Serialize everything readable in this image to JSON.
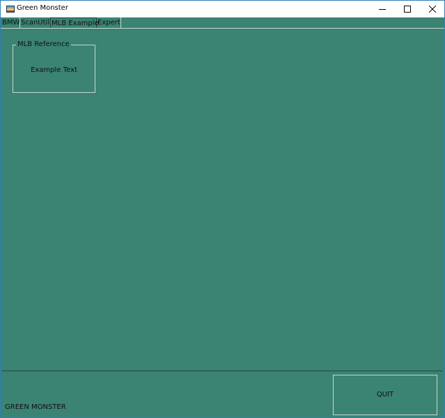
{
  "window": {
    "title": "Green Monster",
    "controls": {
      "minimize_icon": "minimize-icon",
      "maximize_icon": "maximize-icon",
      "close_icon": "close-icon"
    }
  },
  "tabs": [
    {
      "label": "BMW",
      "selected": false
    },
    {
      "label": "ScanUtil",
      "selected": false
    },
    {
      "label": "MLB Example",
      "selected": true
    },
    {
      "label": "Expert",
      "selected": false
    }
  ],
  "group": {
    "label": "MLB Reference",
    "text": "Example Text"
  },
  "footer": {
    "label": "GREEN MONSTER",
    "quit_label": "QUIT"
  },
  "colors": {
    "background": "#3b8372",
    "titlebar": "#ffffff",
    "border": "#2e7eb8"
  }
}
